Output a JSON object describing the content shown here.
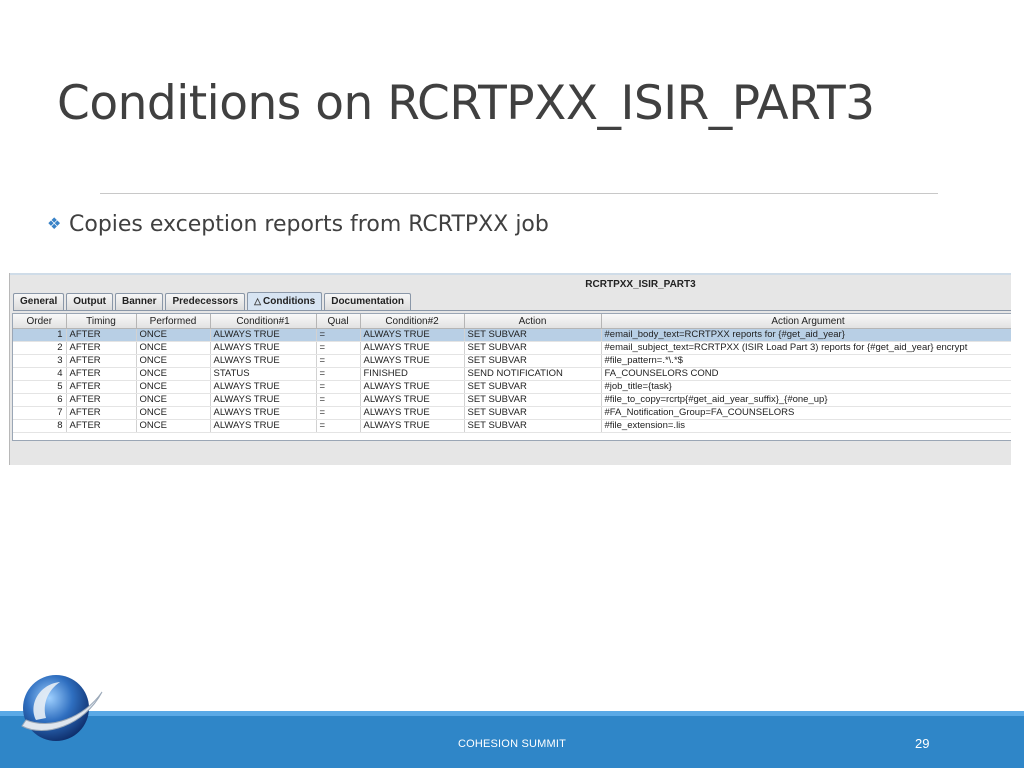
{
  "slide": {
    "title": "Conditions on RCRTPXX_ISIR_PART3",
    "bullet": "Copies exception reports from RCRTPXX job",
    "footer": "COHESION SUMMIT",
    "page_number": "29"
  },
  "app": {
    "window_title": "RCRTPXX_ISIR_PART3",
    "tabs": [
      {
        "label": "General",
        "active": false
      },
      {
        "label": "Output",
        "active": false
      },
      {
        "label": "Banner",
        "active": false
      },
      {
        "label": "Predecessors",
        "active": false
      },
      {
        "label": "Conditions",
        "active": true
      },
      {
        "label": "Documentation",
        "active": false
      }
    ],
    "columns": [
      "Order",
      "Timing",
      "Performed",
      "Condition#1",
      "Qual",
      "Condition#2",
      "Action",
      "Action Argument"
    ],
    "rows": [
      {
        "order": "1",
        "timing": "AFTER",
        "performed": "ONCE",
        "cond1": "ALWAYS TRUE",
        "qual": "=",
        "cond2": "ALWAYS TRUE",
        "action": "SET SUBVAR",
        "argument": "#email_body_text=RCRTPXX reports for {#get_aid_year}",
        "selected": true
      },
      {
        "order": "2",
        "timing": "AFTER",
        "performed": "ONCE",
        "cond1": "ALWAYS TRUE",
        "qual": "=",
        "cond2": "ALWAYS TRUE",
        "action": "SET SUBVAR",
        "argument": "#email_subject_text=RCRTPXX (ISIR Load Part 3) reports for {#get_aid_year} encrypt",
        "selected": false
      },
      {
        "order": "3",
        "timing": "AFTER",
        "performed": "ONCE",
        "cond1": "ALWAYS TRUE",
        "qual": "=",
        "cond2": "ALWAYS TRUE",
        "action": "SET SUBVAR",
        "argument": "#file_pattern=.*\\.*$",
        "selected": false
      },
      {
        "order": "4",
        "timing": "AFTER",
        "performed": "ONCE",
        "cond1": "STATUS",
        "qual": "=",
        "cond2": "FINISHED",
        "action": "SEND NOTIFICATION",
        "argument": "FA_COUNSELORS COND",
        "selected": false
      },
      {
        "order": "5",
        "timing": "AFTER",
        "performed": "ONCE",
        "cond1": "ALWAYS TRUE",
        "qual": "=",
        "cond2": "ALWAYS TRUE",
        "action": "SET SUBVAR",
        "argument": "#job_title={task}",
        "selected": false
      },
      {
        "order": "6",
        "timing": "AFTER",
        "performed": "ONCE",
        "cond1": "ALWAYS TRUE",
        "qual": "=",
        "cond2": "ALWAYS TRUE",
        "action": "SET SUBVAR",
        "argument": "#file_to_copy=rcrtp{#get_aid_year_suffix}_{#one_up}",
        "selected": false
      },
      {
        "order": "7",
        "timing": "AFTER",
        "performed": "ONCE",
        "cond1": "ALWAYS TRUE",
        "qual": "=",
        "cond2": "ALWAYS TRUE",
        "action": "SET SUBVAR",
        "argument": "#FA_Notification_Group=FA_COUNSELORS",
        "selected": false
      },
      {
        "order": "8",
        "timing": "AFTER",
        "performed": "ONCE",
        "cond1": "ALWAYS TRUE",
        "qual": "=",
        "cond2": "ALWAYS TRUE",
        "action": "SET SUBVAR",
        "argument": "#file_extension=.lis",
        "selected": false
      }
    ]
  },
  "colors": {
    "footer_bar": "#2f86c8",
    "footer_accent": "#5aa9e6",
    "selected_row": "#b8cfe5",
    "title_text": "#404040"
  },
  "icons": {
    "bullet": "diamond-cluster-icon",
    "active_tab": "triangle-warning-icon",
    "logo": "globe-swoosh-logo"
  }
}
